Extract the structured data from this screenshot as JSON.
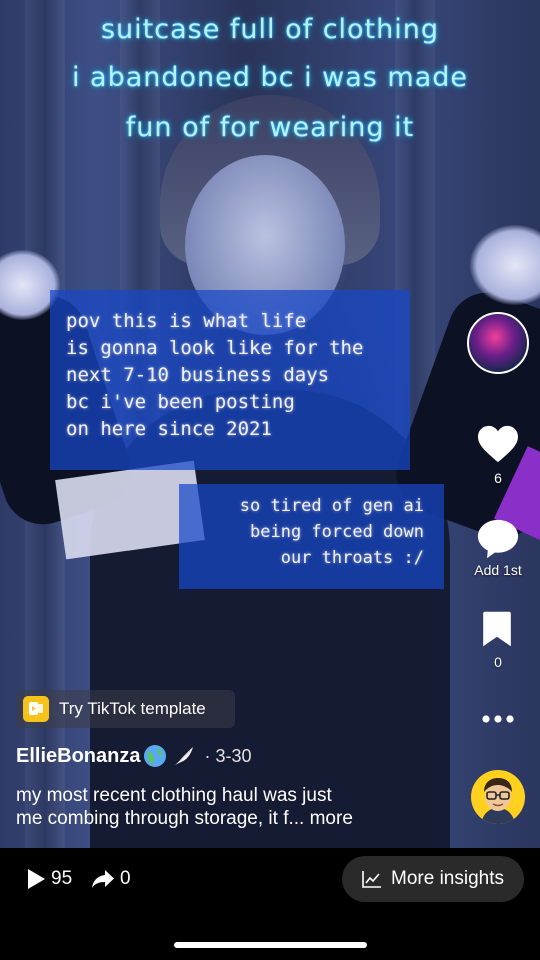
{
  "overlay": {
    "title_lines": [
      "suitcase full of clothing",
      "i abandoned bc i was made",
      "fun of for wearing it"
    ],
    "box1_lines": [
      "pov this is what life",
      "is gonna look like for the",
      "next 7-10 business days",
      "bc i've been posting",
      "on here since 2021"
    ],
    "box2_lines": [
      "so tired of gen ai",
      "being forced down",
      "our throats :/"
    ]
  },
  "rail": {
    "likes_count": "6",
    "comments_label": "Add 1st",
    "saves_count": "0"
  },
  "template_button": {
    "label": "Try TikTok template"
  },
  "post": {
    "username": "EllieBonanza",
    "date": "· 3-30",
    "caption_line1": "my most recent clothing haul was just",
    "caption_line2": "me combing through storage, it f...",
    "more_label": "more"
  },
  "bottom": {
    "views": "95",
    "shares": "0",
    "insights_label": "More insights"
  },
  "icons": {
    "like": "heart-icon",
    "comment": "comment-bubble-icon",
    "save": "bookmark-icon",
    "more": "more-dots-icon",
    "template": "template-icon",
    "globe": "globe-icon",
    "wing": "wing-icon",
    "play": "play-icon",
    "share": "share-arrow-icon",
    "chart": "chart-icon"
  },
  "colors": {
    "caption_glow": "#b9efff",
    "text_box": "#1848c8",
    "template_icon": "#f7c21a",
    "profile_bg": "#ffd11e",
    "insights_pill": "#2a2a2a"
  }
}
